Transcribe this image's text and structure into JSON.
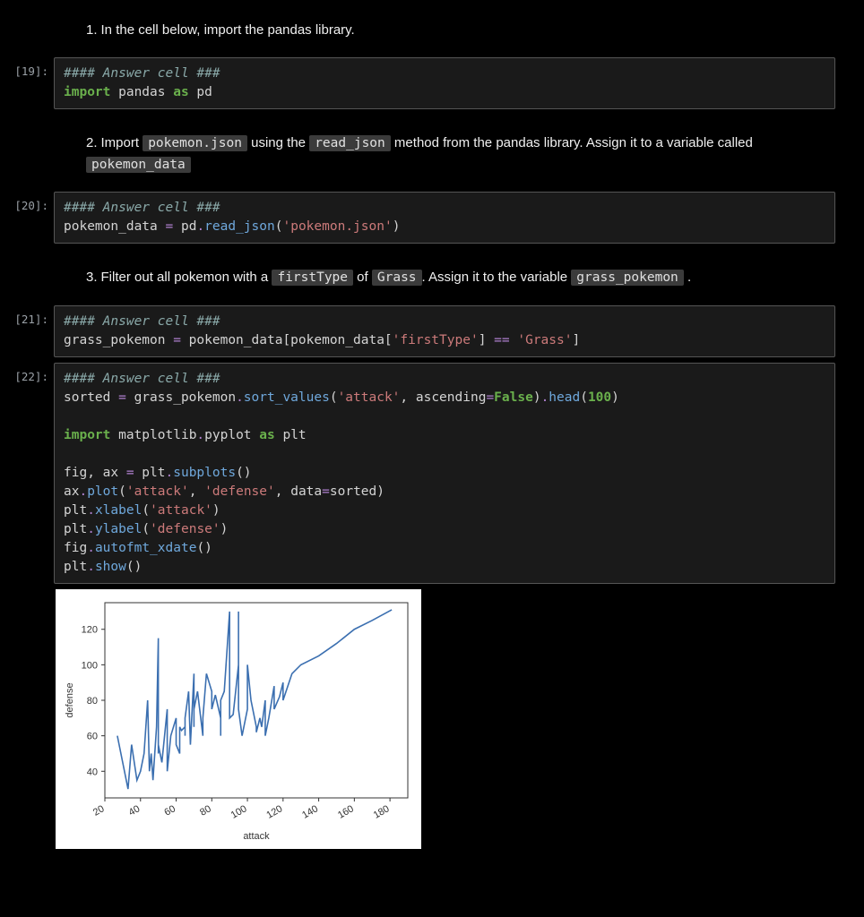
{
  "markdown": {
    "q1": {
      "num": "1.",
      "text": "In the cell below, import the pandas library."
    },
    "q2": {
      "num": "2.",
      "t1": "Import ",
      "c1": "pokemon.json",
      "t2": " using the ",
      "c2": "read_json",
      "t3": " method from the pandas library. Assign it to a variable called ",
      "c3": "pokemon_data"
    },
    "q3": {
      "num": "3.",
      "t1": "Filter out all pokemon with a ",
      "c1": "firstType",
      "t2": " of ",
      "c2": "Grass",
      "t3": ". Assign it to the variable ",
      "c3": "grass_pokemon",
      "t4": " ."
    }
  },
  "prompts": {
    "p19": "[19]:",
    "p20": "[20]:",
    "p21": "[21]:",
    "p22": "[22]:"
  },
  "code": {
    "comment": "#### Answer cell ###",
    "c19_l1a": "import",
    "c19_l1b": " pandas ",
    "c19_l1c": "as",
    "c19_l1d": " pd",
    "c20_l1": "pokemon_data ",
    "c20_op": "=",
    "c20_l1b": " pd",
    "c20_dot": ".",
    "c20_fn": "read_json",
    "c20_paren": "(",
    "c20_str": "'pokemon.json'",
    "c20_close": ")",
    "c21_l1": "grass_pokemon ",
    "c21_op": "=",
    "c21_l1b": " pokemon_data[pokemon_data[",
    "c21_s1": "'firstType'",
    "c21_mid": "] ",
    "c21_eq": "==",
    "c21_sp": " ",
    "c21_s2": "'Grass'",
    "c21_end": "]",
    "c22": {
      "l1a": "sorted ",
      "l1eq": "=",
      "l1b": " grass_pokemon",
      "l1dot1": ".",
      "l1fn1": "sort_values",
      "l1p1": "(",
      "l1s1": "'attack'",
      "l1c": ", ascending",
      "l1eq2": "=",
      "l1false": "False",
      "l1p2": ")",
      "l1dot2": ".",
      "l1fn2": "head",
      "l1p3": "(",
      "l1n": "100",
      "l1p4": ")",
      "l2a": "import",
      "l2b": " matplotlib",
      "l2dot": ".",
      "l2c": "pyplot ",
      "l2as": "as",
      "l2d": " plt",
      "l3": "fig, ax ",
      "l3eq": "=",
      "l3b": " plt",
      "l3dot": ".",
      "l3fn": "subplots",
      "l3p": "()",
      "l4": "ax",
      "l4dot": ".",
      "l4fn": "plot",
      "l4p": "(",
      "l4s1": "'attack'",
      "l4c1": ", ",
      "l4s2": "'defense'",
      "l4c2": ", data",
      "l4eq": "=",
      "l4d": "sorted)",
      "l5": "plt",
      "l5dot": ".",
      "l5fn": "xlabel",
      "l5p": "(",
      "l5s": "'attack'",
      "l5c": ")",
      "l6": "plt",
      "l6dot": ".",
      "l6fn": "ylabel",
      "l6p": "(",
      "l6s": "'defense'",
      "l6c": ")",
      "l7": "fig",
      "l7dot": ".",
      "l7fn": "autofmt_xdate",
      "l7p": "()",
      "l8": "plt",
      "l8dot": ".",
      "l8fn": "show",
      "l8p": "()"
    }
  },
  "chart_data": {
    "type": "line",
    "xlabel": "attack",
    "ylabel": "defense",
    "xlim": [
      20,
      190
    ],
    "ylim": [
      25,
      135
    ],
    "xticks": [
      20,
      40,
      60,
      80,
      100,
      120,
      140,
      160,
      180
    ],
    "yticks": [
      40,
      60,
      80,
      100,
      120
    ],
    "series": [
      {
        "name": "defense",
        "x": [
          27,
          30,
          33,
          35,
          38,
          40,
          42,
          44,
          45,
          46,
          47,
          49,
          50,
          50,
          50,
          52,
          55,
          55,
          55,
          57,
          60,
          60,
          62,
          62,
          63,
          65,
          65,
          65,
          67,
          68,
          70,
          70,
          70,
          72,
          75,
          75,
          77,
          80,
          80,
          82,
          85,
          85,
          85,
          87,
          90,
          90,
          92,
          95,
          95,
          95,
          97,
          100,
          100,
          100,
          102,
          105,
          105,
          107,
          108,
          110,
          110,
          112,
          115,
          115,
          118,
          120,
          120,
          125,
          130,
          140,
          150,
          160,
          170,
          181
        ],
        "y": [
          60,
          45,
          30,
          55,
          35,
          40,
          50,
          80,
          40,
          50,
          35,
          65,
          115,
          50,
          55,
          45,
          75,
          50,
          40,
          60,
          70,
          55,
          50,
          65,
          63,
          65,
          60,
          70,
          85,
          55,
          95,
          65,
          75,
          85,
          60,
          70,
          95,
          85,
          75,
          83,
          70,
          60,
          80,
          85,
          130,
          70,
          72,
          100,
          130,
          75,
          60,
          75,
          90,
          100,
          80,
          65,
          62,
          70,
          65,
          80,
          60,
          70,
          88,
          75,
          82,
          90,
          80,
          95,
          100,
          105,
          112,
          120,
          125,
          131
        ]
      }
    ]
  }
}
